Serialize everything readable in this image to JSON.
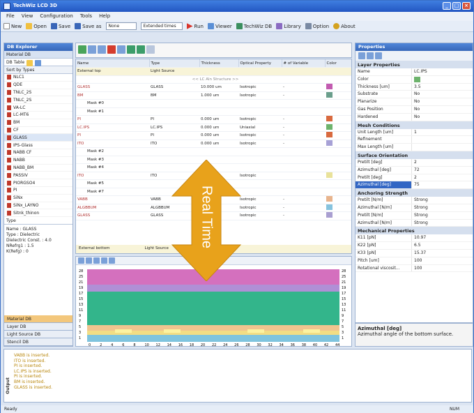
{
  "app": {
    "title": "TechWiz LCD 3D"
  },
  "menu": [
    "File",
    "View",
    "Configuration",
    "Tools",
    "Help"
  ],
  "toolbar": {
    "new": "New",
    "open": "Open",
    "save": "Save",
    "save_as": "Save as",
    "select1": "None",
    "select2": "Extended times",
    "run": "Run",
    "viewer": "Viewer",
    "techwiz_db": "TechWiz DB",
    "library": "Library",
    "option": "Option",
    "about": "About"
  },
  "left": {
    "header": "DB Explorer",
    "subheader": "Material DB",
    "search_label": "DB Table",
    "sort": "Sort by Types",
    "items": [
      "NLC1",
      "QDE",
      "TNLC_2S",
      "TNLC_2S",
      "VA-LC",
      "LC-MT6",
      "BM",
      "CF",
      "GLASS",
      "IPS-Glass",
      "NABB CF",
      "NABB",
      "NABB_BM",
      "PASSIV",
      "PIORGSO4",
      "PI",
      "SiNx",
      "SiNx_LAYNO",
      "Sitnk_thinon"
    ],
    "type_label": "Type",
    "info": [
      "Name : GLASS",
      "Type : Dielectric",
      "Dielectric Const. : 4.0",
      "NRefrg1 : 1.5",
      "K(Refg) : 0"
    ],
    "db_items": [
      "Material DB",
      "Layer DB",
      "Light Source DB",
      "Stencil DB"
    ]
  },
  "grid": {
    "headers": [
      "Name",
      "Type",
      "Thickness",
      "Optical Property",
      "# of Variable",
      "Color"
    ],
    "external_top": "External top",
    "light_source": "Light Source",
    "lc_layer": "<< LC Aln Structure >>",
    "external_bottom": "External bottom",
    "rows": [
      {
        "name": "GLASS",
        "type": "GLASS",
        "thick": "10.000 um",
        "opt": "Isotropic",
        "var": "-",
        "color": "#c25bb0"
      },
      {
        "name": "BM",
        "type": "BM",
        "thick": "1.000 um",
        "opt": "Isotropic",
        "var": "-",
        "color": "#6a9e8c"
      },
      {
        "name": "Mask #0",
        "type": "",
        "thick": "",
        "opt": "",
        "var": "",
        "color": ""
      },
      {
        "name": "Mask #1",
        "type": "",
        "thick": "",
        "opt": "",
        "var": "",
        "color": ""
      },
      {
        "name": "PI",
        "type": "PI",
        "thick": "0.000 um",
        "opt": "Isotropic",
        "var": "-",
        "color": "#d96a3f"
      },
      {
        "name": "LC.IPS",
        "type": "LC.IPS",
        "thick": "0.000 um",
        "opt": "Uniaxial",
        "var": "-",
        "color": "#6db36c"
      },
      {
        "name": "PI",
        "type": "PI",
        "thick": "0.000 um",
        "opt": "Isotropic",
        "var": "-",
        "color": "#d96a3f"
      },
      {
        "name": "ITO",
        "type": "ITO",
        "thick": "0.000 um",
        "opt": "Isotropic",
        "var": "-",
        "color": "#a7a1d6"
      },
      {
        "name": "Mask #2",
        "type": "",
        "thick": "",
        "opt": "",
        "var": "",
        "color": ""
      },
      {
        "name": "Mask #3",
        "type": "",
        "thick": "",
        "opt": "",
        "var": "",
        "color": ""
      },
      {
        "name": "Mask #4",
        "type": "",
        "thick": "",
        "opt": "",
        "var": "",
        "color": ""
      },
      {
        "name": "ITO",
        "type": "ITO",
        "thick": "",
        "opt": "Isotropic",
        "var": "",
        "color": "#e9e29a"
      },
      {
        "name": "Mask #5",
        "type": "",
        "thick": "",
        "opt": "",
        "var": "",
        "color": ""
      },
      {
        "name": "Mask #7",
        "type": "",
        "thick": "",
        "opt": "",
        "var": "",
        "color": ""
      },
      {
        "name": "VABB",
        "type": "VABB",
        "thick": "",
        "opt": "Isotropic",
        "var": "-",
        "color": "#e8b48d"
      },
      {
        "name": "ALGBBUM",
        "type": "ALGBBUM",
        "thick": "",
        "opt": "Isotropic",
        "var": "-",
        "color": "#86c3de"
      },
      {
        "name": "GLASS",
        "type": "GLASS",
        "thick": "",
        "opt": "Isotropic",
        "var": "-",
        "color": "#a99fd1"
      }
    ]
  },
  "overlay": {
    "text": "Real Time"
  },
  "plot": {
    "y_ticks": [
      "28",
      "25",
      "21",
      "19",
      "17",
      "15",
      "13",
      "11",
      "9",
      "7",
      "5",
      "3",
      "1"
    ],
    "x_ticks": [
      "0",
      "2",
      "4",
      "6",
      "8",
      "10",
      "12",
      "14",
      "16",
      "18",
      "20",
      "22",
      "24",
      "26",
      "28",
      "30",
      "32",
      "34",
      "36",
      "38",
      "40",
      "42",
      "44"
    ],
    "colors": {
      "top": "#d470be",
      "band": "#b08fd6",
      "lc": "#33b58b",
      "layer1": "#f0c48f",
      "layer2": "#f2dd84",
      "glass": "#7fc4de"
    }
  },
  "props": {
    "header": "Properties",
    "sections": [
      {
        "title": "Layer Properties",
        "rows": [
          [
            "Name",
            "LC.IPS"
          ],
          [
            "Color",
            ""
          ],
          [
            "Thickness [um]",
            "3.5"
          ],
          [
            "Substrate",
            "No"
          ],
          [
            "Planarize",
            "No"
          ],
          [
            "Gas Position",
            "No"
          ],
          [
            "Hardened",
            "No"
          ]
        ]
      },
      {
        "title": "Mesh Conditions",
        "rows": [
          [
            "Unit Length [um]",
            "1"
          ],
          [
            "Refinement",
            ""
          ],
          [
            "Max Length [um]",
            ""
          ]
        ]
      },
      {
        "title": "Surface Orientation",
        "rows": [
          [
            "Pretilt [deg]",
            "2"
          ],
          [
            "Azimuthal [deg]",
            "72"
          ],
          [
            "Pretilt [deg]",
            "2"
          ],
          [
            "Azimuthal [deg]",
            "75"
          ]
        ]
      },
      {
        "title": "Anchoring Strength",
        "rows": [
          [
            "Pretilt [N/m]",
            "Strong"
          ],
          [
            "Azimuthal [N/m]",
            "Strong"
          ],
          [
            "Pretilt [N/m]",
            "Strong"
          ],
          [
            "Azimuthal [N/m]",
            "Strong"
          ]
        ]
      },
      {
        "title": "Mechanical Properties",
        "rows": [
          [
            "K11 [pN]",
            "10.97"
          ],
          [
            "K22 [pN]",
            "6.5"
          ],
          [
            "K33 [pN]",
            "15.37"
          ],
          [
            "Pitch [um]",
            "100"
          ],
          [
            "Rotational viscosit...",
            "100"
          ]
        ]
      }
    ],
    "desc_title": "Azimuthal [deg]",
    "desc_text": "Azimuthal angle of the bottom surface."
  },
  "output": {
    "lines": [
      "VABB is inserted.",
      "ITO is inserted.",
      "PI is inserted.",
      "LC.IPS is inserted.",
      "PI is inserted.",
      "BM is inserted.",
      "GLASS is inserted."
    ],
    "label": "Output"
  },
  "status": {
    "left": "Ready",
    "right": "NUM"
  }
}
